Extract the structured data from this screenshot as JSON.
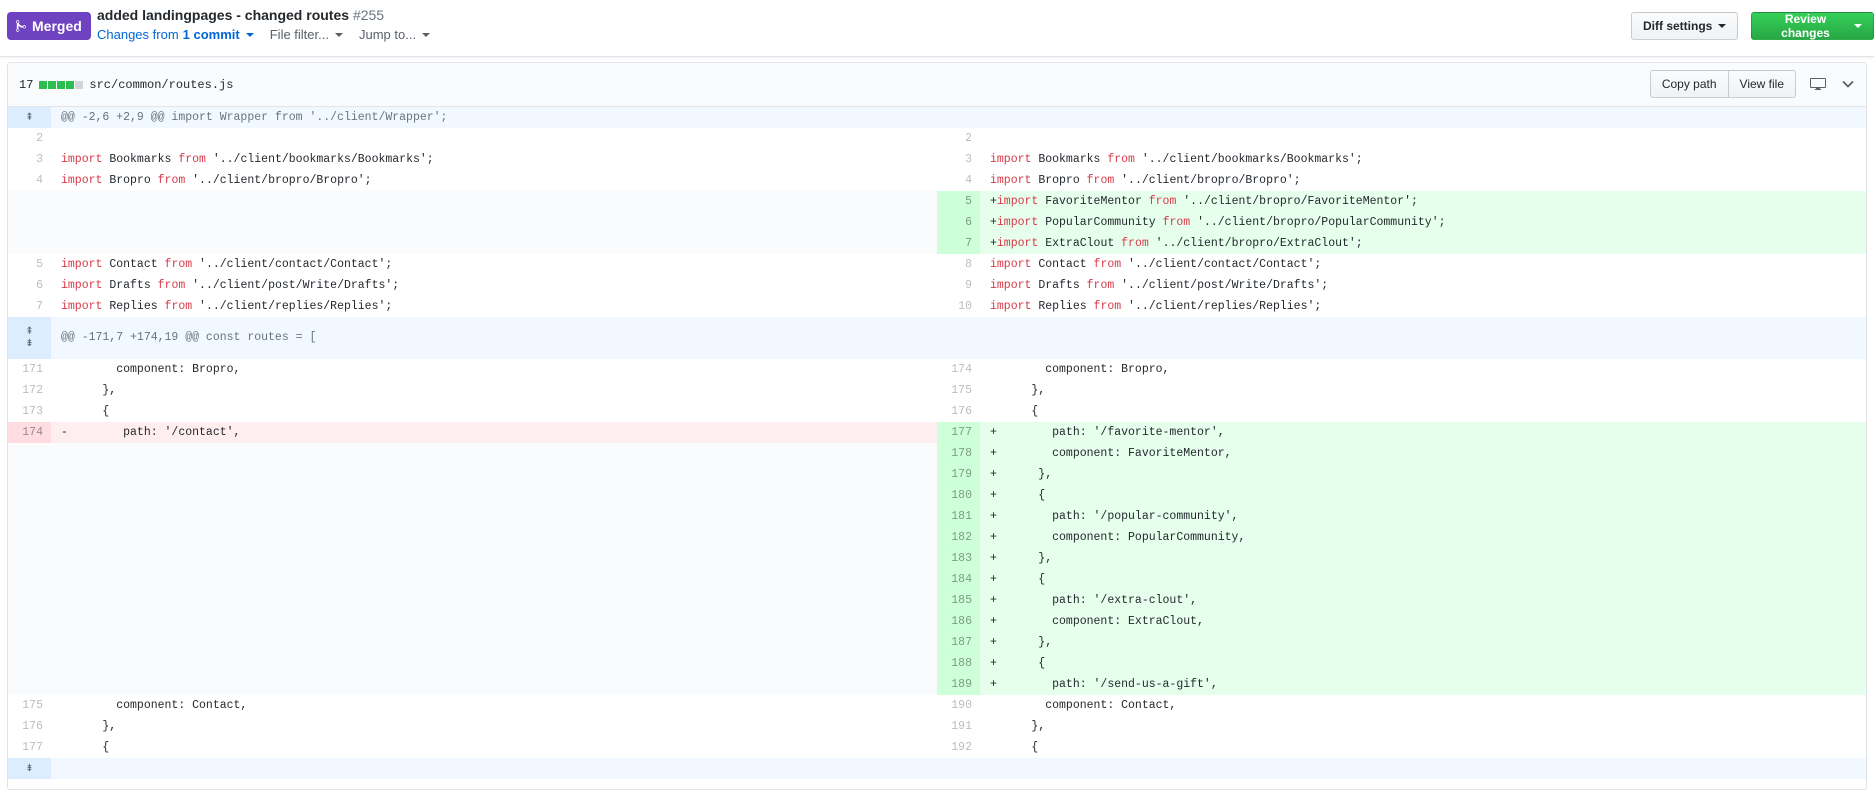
{
  "header": {
    "state": "Merged",
    "title": "added landingpages - changed routes",
    "number": "#255",
    "changes_prefix": "Changes from",
    "changes_link": "1 commit",
    "file_filter": "File filter...",
    "jump_to": "Jump to...",
    "diff_settings": "Diff settings",
    "review_changes": "Review changes",
    "colors": {
      "merged": "#6f42c1",
      "review": "#28a745"
    }
  },
  "file": {
    "changed_count": "17",
    "diffstat_blocks": [
      "add",
      "add",
      "add",
      "add",
      "neutral"
    ],
    "path": "src/common/routes.js",
    "copy_path": "Copy path",
    "view_file": "View file",
    "icons": [
      "desktop-icon",
      "chevron-down-icon"
    ]
  },
  "hunks": [
    {
      "text": "@@ -2,6 +2,9 @@ import Wrapper from '../client/Wrapper';"
    },
    {
      "text": "@@ -171,7 +174,19 @@ const routes = ["
    }
  ],
  "rows": [
    {
      "kind": "ctx",
      "l": "2",
      "lc": "",
      "r": "2",
      "rc": ""
    },
    {
      "kind": "ctx",
      "l": "3",
      "lc": "import Bookmarks from '../client/bookmarks/Bookmarks';",
      "r": "3",
      "rc": "import Bookmarks from '../client/bookmarks/Bookmarks';"
    },
    {
      "kind": "ctx",
      "l": "4",
      "lc": "import Bropro from '../client/bropro/Bropro';",
      "r": "4",
      "rc": "import Bropro from '../client/bropro/Bropro';"
    },
    {
      "kind": "add",
      "r": "5",
      "rc": "+import FavoriteMentor from '../client/bropro/FavoriteMentor';"
    },
    {
      "kind": "add",
      "r": "6",
      "rc": "+import PopularCommunity from '../client/bropro/PopularCommunity';"
    },
    {
      "kind": "add",
      "r": "7",
      "rc": "+import ExtraClout from '../client/bropro/ExtraClout';"
    },
    {
      "kind": "ctx",
      "l": "5",
      "lc": "import Contact from '../client/contact/Contact';",
      "r": "8",
      "rc": "import Contact from '../client/contact/Contact';"
    },
    {
      "kind": "ctx",
      "l": "6",
      "lc": "import Drafts from '../client/post/Write/Drafts';",
      "r": "9",
      "rc": "import Drafts from '../client/post/Write/Drafts';"
    },
    {
      "kind": "ctx",
      "l": "7",
      "lc": "import Replies from '../client/replies/Replies';",
      "r": "10",
      "rc": "import Replies from '../client/replies/Replies';"
    }
  ],
  "rows2": [
    {
      "kind": "ctx",
      "l": "171",
      "lc": "        component: Bropro,",
      "r": "174",
      "rc": "        component: Bropro,"
    },
    {
      "kind": "ctx",
      "l": "172",
      "lc": "      },",
      "r": "175",
      "rc": "      },"
    },
    {
      "kind": "ctx",
      "l": "173",
      "lc": "      {",
      "r": "176",
      "rc": "      {"
    },
    {
      "kind": "chg",
      "l": "174",
      "lc": "-        path: '/contact',",
      "r": "177",
      "rc": "+        path: '/favorite-mentor',"
    },
    {
      "kind": "add",
      "r": "178",
      "rc": "+        component: FavoriteMentor,"
    },
    {
      "kind": "add",
      "r": "179",
      "rc": "+      },"
    },
    {
      "kind": "add",
      "r": "180",
      "rc": "+      {"
    },
    {
      "kind": "add",
      "r": "181",
      "rc": "+        path: '/popular-community',"
    },
    {
      "kind": "add",
      "r": "182",
      "rc": "+        component: PopularCommunity,"
    },
    {
      "kind": "add",
      "r": "183",
      "rc": "+      },"
    },
    {
      "kind": "add",
      "r": "184",
      "rc": "+      {"
    },
    {
      "kind": "add",
      "r": "185",
      "rc": "+        path: '/extra-clout',"
    },
    {
      "kind": "add",
      "r": "186",
      "rc": "+        component: ExtraClout,"
    },
    {
      "kind": "add",
      "r": "187",
      "rc": "+      },"
    },
    {
      "kind": "add",
      "r": "188",
      "rc": "+      {"
    },
    {
      "kind": "add",
      "r": "189",
      "rc": "+        path: '/send-us-a-gift',"
    },
    {
      "kind": "ctx",
      "l": "175",
      "lc": "        component: Contact,",
      "r": "190",
      "rc": "        component: Contact,"
    },
    {
      "kind": "ctx",
      "l": "176",
      "lc": "      },",
      "r": "191",
      "rc": "      },"
    },
    {
      "kind": "ctx",
      "l": "177",
      "lc": "      {",
      "r": "192",
      "rc": "      {"
    }
  ]
}
